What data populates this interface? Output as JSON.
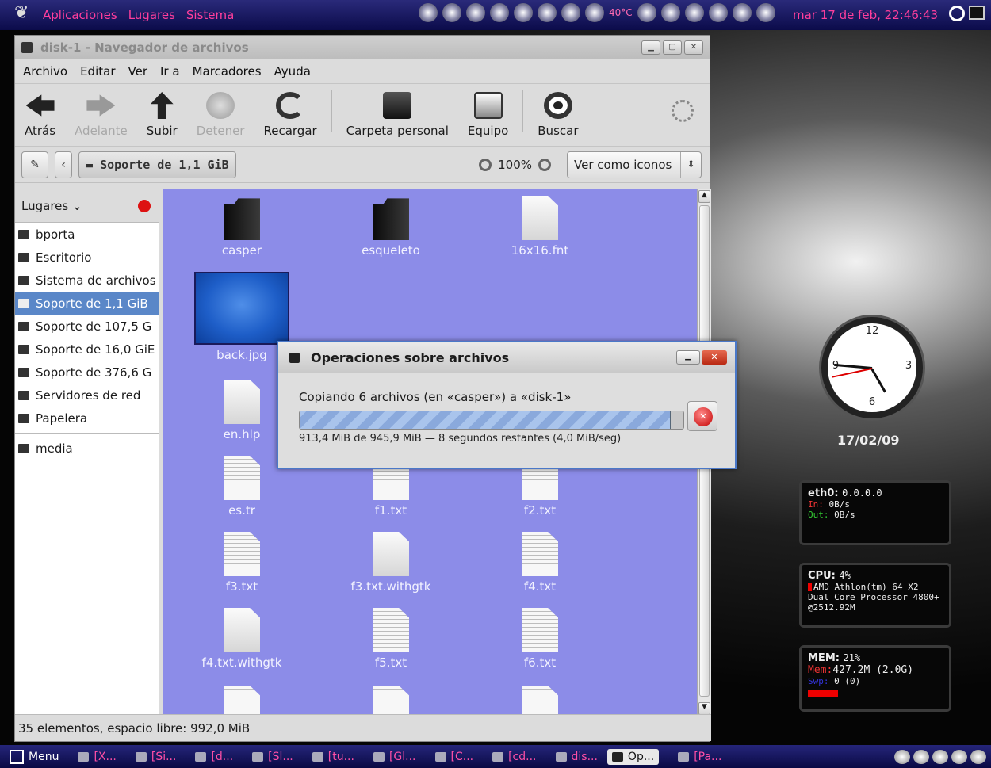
{
  "top_panel": {
    "menus": [
      "Aplicaciones",
      "Lugares",
      "Sistema"
    ],
    "temperature": "40°C",
    "datetime": "mar 17 de feb, 22:46:43"
  },
  "window": {
    "title": "disk-1 - Navegador de archivos",
    "menu": [
      "Archivo",
      "Editar",
      "Ver",
      "Ir a",
      "Marcadores",
      "Ayuda"
    ],
    "toolbar": {
      "back": "Atrás",
      "forward": "Adelante",
      "up": "Subir",
      "stop": "Detener",
      "reload": "Recargar",
      "home": "Carpeta personal",
      "computer": "Equipo",
      "search": "Buscar"
    },
    "location": "Soporte de 1,1 GiB",
    "zoom": "100%",
    "view_mode": "Ver como iconos",
    "sidebar": {
      "header": "Lugares",
      "items": [
        "bporta",
        "Escritorio",
        "Sistema de archivos",
        "Soporte de 1,1 GiB",
        "Soporte de 107,5 G",
        "Soporte de 16,0 GiE",
        "Soporte de 376,6 G",
        "Servidores de red",
        "Papelera"
      ],
      "selected_index": 3,
      "bookmarks": [
        "media"
      ]
    },
    "files": [
      "casper",
      "esqueleto",
      "16x16.fnt",
      "back.jpg",
      "en.hlp",
      "es.tr",
      "f1.txt",
      "f2.txt",
      "f3.txt",
      "f3.txt.withgtk",
      "f4.txt",
      "f4.txt.withgtk",
      "f5.txt",
      "f6.txt"
    ],
    "status": "35 elementos, espacio libre: 992,0 MiB"
  },
  "dialog": {
    "title": "Operaciones sobre archivos",
    "message": "Copiando 6 archivos (en «casper») a «disk-1»",
    "progress_fraction": 0.966,
    "status": "913,4 MiB de 945,9 MiB — 8 segundos restantes (4,0 MiB/seg)"
  },
  "desktop": {
    "clock_date": "17/02/09",
    "eth": {
      "label": "eth0:",
      "ip": "0.0.0.0",
      "in_label": "In:",
      "in": "0B/s",
      "out_label": "Out:",
      "out": "0B/s"
    },
    "cpu": {
      "label": "CPU:",
      "percent": "4%",
      "model": "AMD Athlon(tm) 64 X2 Dual Core Processor 4800+ @2512.92M"
    },
    "mem": {
      "label": "MEM:",
      "percent": "21%",
      "mem_label": "Mem:",
      "mem_value": "427.2M (2.0G)",
      "swap_label": "Swp:",
      "swap_value": "0 (0)"
    }
  },
  "taskbar": {
    "menu": "Menu",
    "tasks": [
      "[X...",
      "[Si...",
      "[d...",
      "[Sl...",
      "[tu...",
      "[Gl...",
      "[C...",
      "[cd...",
      "dis...",
      "Op...",
      "[Pa..."
    ],
    "active_index": 9
  }
}
